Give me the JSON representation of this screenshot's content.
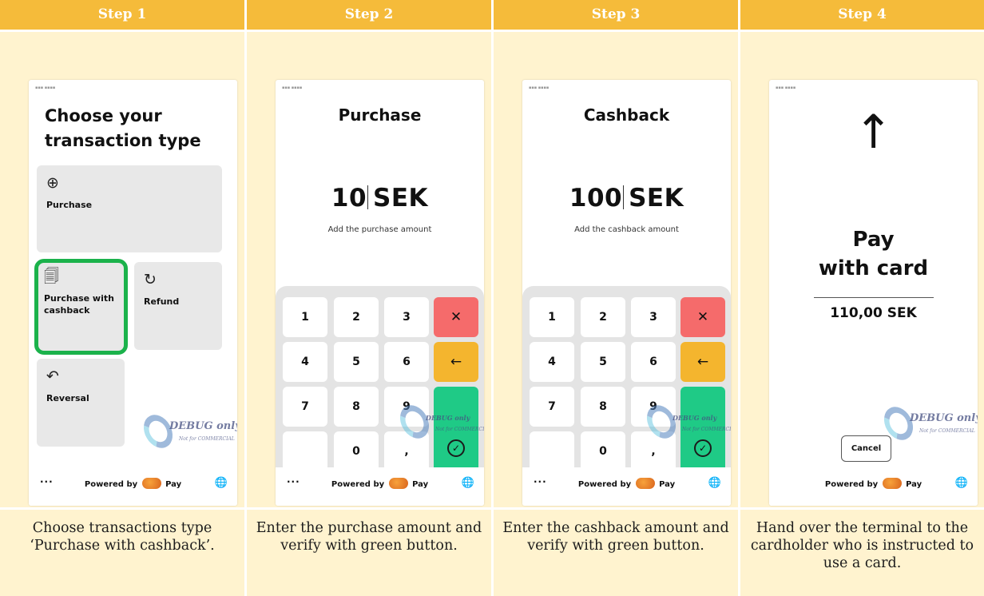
{
  "steps": [
    {
      "header": "Step 1",
      "caption": "Choose transactions type ‘Purchase with cashback’.",
      "screen": {
        "title": "Choose your transaction type",
        "tiles": [
          {
            "icon": "plus-circle-icon",
            "glyph": "⊕",
            "label": "Purchase"
          },
          {
            "icon": "cashback-receipt-icon",
            "glyph": "🗐",
            "label": "Purchase with cashback",
            "selected": true
          },
          {
            "icon": "refund-icon",
            "glyph": "↻",
            "label": "Refund"
          },
          {
            "icon": "reversal-icon",
            "glyph": "↶",
            "label": "Reversal"
          }
        ]
      }
    },
    {
      "header": "Step 2",
      "caption": "Enter the purchase amount and verify with green button.",
      "screen": {
        "title": "Purchase",
        "amount": "10",
        "currency": "SEK",
        "hint": "Add the purchase amount"
      }
    },
    {
      "header": "Step 3",
      "caption": "Enter the cashback amount and verify with green button.",
      "screen": {
        "title": "Cashback",
        "amount": "100",
        "currency": "SEK",
        "hint": "Add the cashback amount"
      }
    },
    {
      "header": "Step 4",
      "caption": "Hand over the terminal to the cardholder who is instructed to use a card.",
      "screen": {
        "line1": "Pay",
        "line2": "with card",
        "amount": "110,00 SEK",
        "cancel": "Cancel"
      }
    }
  ],
  "keypad": {
    "keys": [
      "1",
      "2",
      "3",
      "4",
      "5",
      "6",
      "7",
      "8",
      "9",
      "0",
      ","
    ],
    "clear": "✕",
    "back": "←",
    "ok": "✓"
  },
  "footer": {
    "more": "···",
    "powered_by": "Powered by",
    "pay": "Pay",
    "globe": "🌐"
  },
  "watermark": {
    "text": "DEBUG only",
    "sub": "Not for COMMERCIAL"
  },
  "colors": {
    "header": "#f5bb3a",
    "panel": "#fff3cf",
    "selected": "#1bb24b",
    "key_red": "#f56b6b",
    "key_yellow": "#f4b52e",
    "key_green": "#1fca86"
  }
}
